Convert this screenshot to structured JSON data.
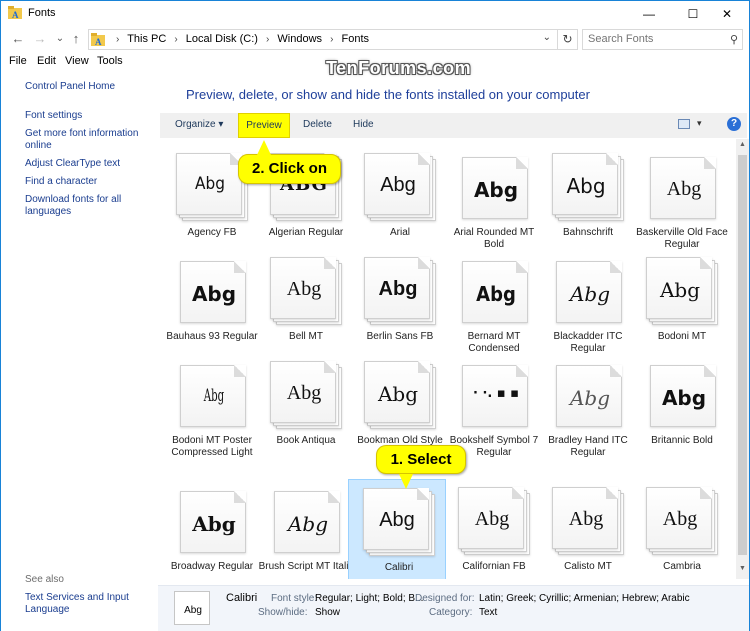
{
  "window": {
    "title": "Fonts",
    "minimize": "—",
    "maximize": "☐",
    "close": "✕"
  },
  "nav": {
    "back": "←",
    "forward": "→",
    "recent": "⌄",
    "up": "↑",
    "breadcrumbs": [
      "This PC",
      "Local Disk (C:)",
      "Windows",
      "Fonts"
    ],
    "separator": "›",
    "dropdown": "⌄",
    "refresh": "↻",
    "search_placeholder": "Search Fonts",
    "search_icon": "⚲"
  },
  "menu": {
    "file": "File",
    "edit": "Edit",
    "view": "View",
    "tools": "Tools"
  },
  "watermark": "TenForums.com",
  "sidebar": {
    "control_panel_home": "Control Panel Home",
    "links": [
      "Font settings",
      "Get more font information online",
      "Adjust ClearType text",
      "Find a character",
      "Download fonts for all languages"
    ],
    "see_also": "See also",
    "see_also_links": [
      "Text Services and Input Language"
    ]
  },
  "main": {
    "heading": "Preview, delete, or show and hide the fonts installed on your computer",
    "toolbar": {
      "organize": "Organize ▾",
      "preview": "Preview",
      "delete": "Delete",
      "hide": "Hide",
      "view_dd": "▾",
      "help": "?"
    }
  },
  "fonts": [
    {
      "name": "Agency FB",
      "sample": "Abg",
      "stacked": true
    },
    {
      "name": "Algerian Regular",
      "sample": "ABG",
      "stacked": true
    },
    {
      "name": "Arial",
      "sample": "Abg",
      "stacked": true
    },
    {
      "name": "Arial Rounded MT Bold",
      "sample": "Abg",
      "stacked": false
    },
    {
      "name": "Bahnschrift",
      "sample": "Abg",
      "stacked": true
    },
    {
      "name": "Baskerville Old Face Regular",
      "sample": "Abg",
      "stacked": false
    },
    {
      "name": "Bauhaus 93 Regular",
      "sample": "Abg",
      "stacked": false
    },
    {
      "name": "Bell MT",
      "sample": "Abg",
      "stacked": true
    },
    {
      "name": "Berlin Sans FB",
      "sample": "Abg",
      "stacked": true
    },
    {
      "name": "Bernard MT Condensed",
      "sample": "Abg",
      "stacked": false
    },
    {
      "name": "Blackadder ITC Regular",
      "sample": "Abg",
      "stacked": false
    },
    {
      "name": "Bodoni MT",
      "sample": "Abg",
      "stacked": true
    },
    {
      "name": "Bodoni MT Poster Compressed Light",
      "sample": "Abg",
      "stacked": false
    },
    {
      "name": "Book Antiqua",
      "sample": "Abg",
      "stacked": true
    },
    {
      "name": "Bookman Old Style",
      "sample": "Abg",
      "stacked": true
    },
    {
      "name": "Bookshelf Symbol 7 Regular",
      "sample": "· ·. ▪ ▪",
      "stacked": false
    },
    {
      "name": "Bradley Hand ITC Regular",
      "sample": "Abg",
      "stacked": false
    },
    {
      "name": "Britannic Bold",
      "sample": "Abg",
      "stacked": false
    },
    {
      "name": "Broadway Regular",
      "sample": "Abg",
      "stacked": false
    },
    {
      "name": "Brush Script MT Italic",
      "sample": "Abg",
      "stacked": false
    },
    {
      "name": "Calibri",
      "sample": "Abg",
      "stacked": true,
      "selected": true
    },
    {
      "name": "Californian FB",
      "sample": "Abg",
      "stacked": true
    },
    {
      "name": "Calisto MT",
      "sample": "Abg",
      "stacked": true
    },
    {
      "name": "Cambria",
      "sample": "Abg",
      "stacked": true
    }
  ],
  "details": {
    "thumb_sample": "Abg",
    "name": "Calibri",
    "font_style_label": "Font style:",
    "font_style_value": "Regular; Light; Bold; B...",
    "show_hide_label": "Show/hide:",
    "show_hide_value": "Show",
    "designed_for_label": "Designed for:",
    "designed_for_value": "Latin; Greek; Cyrillic; Armenian; Hebrew; Arabic",
    "category_label": "Category:",
    "category_value": "Text"
  },
  "callouts": {
    "step2": "2. Click on",
    "step1": "1. Select"
  },
  "colors": {
    "highlight": "#ffff00",
    "selection": "#cce8ff",
    "link": "#1a3d8f",
    "heading": "#1e3f9a"
  }
}
